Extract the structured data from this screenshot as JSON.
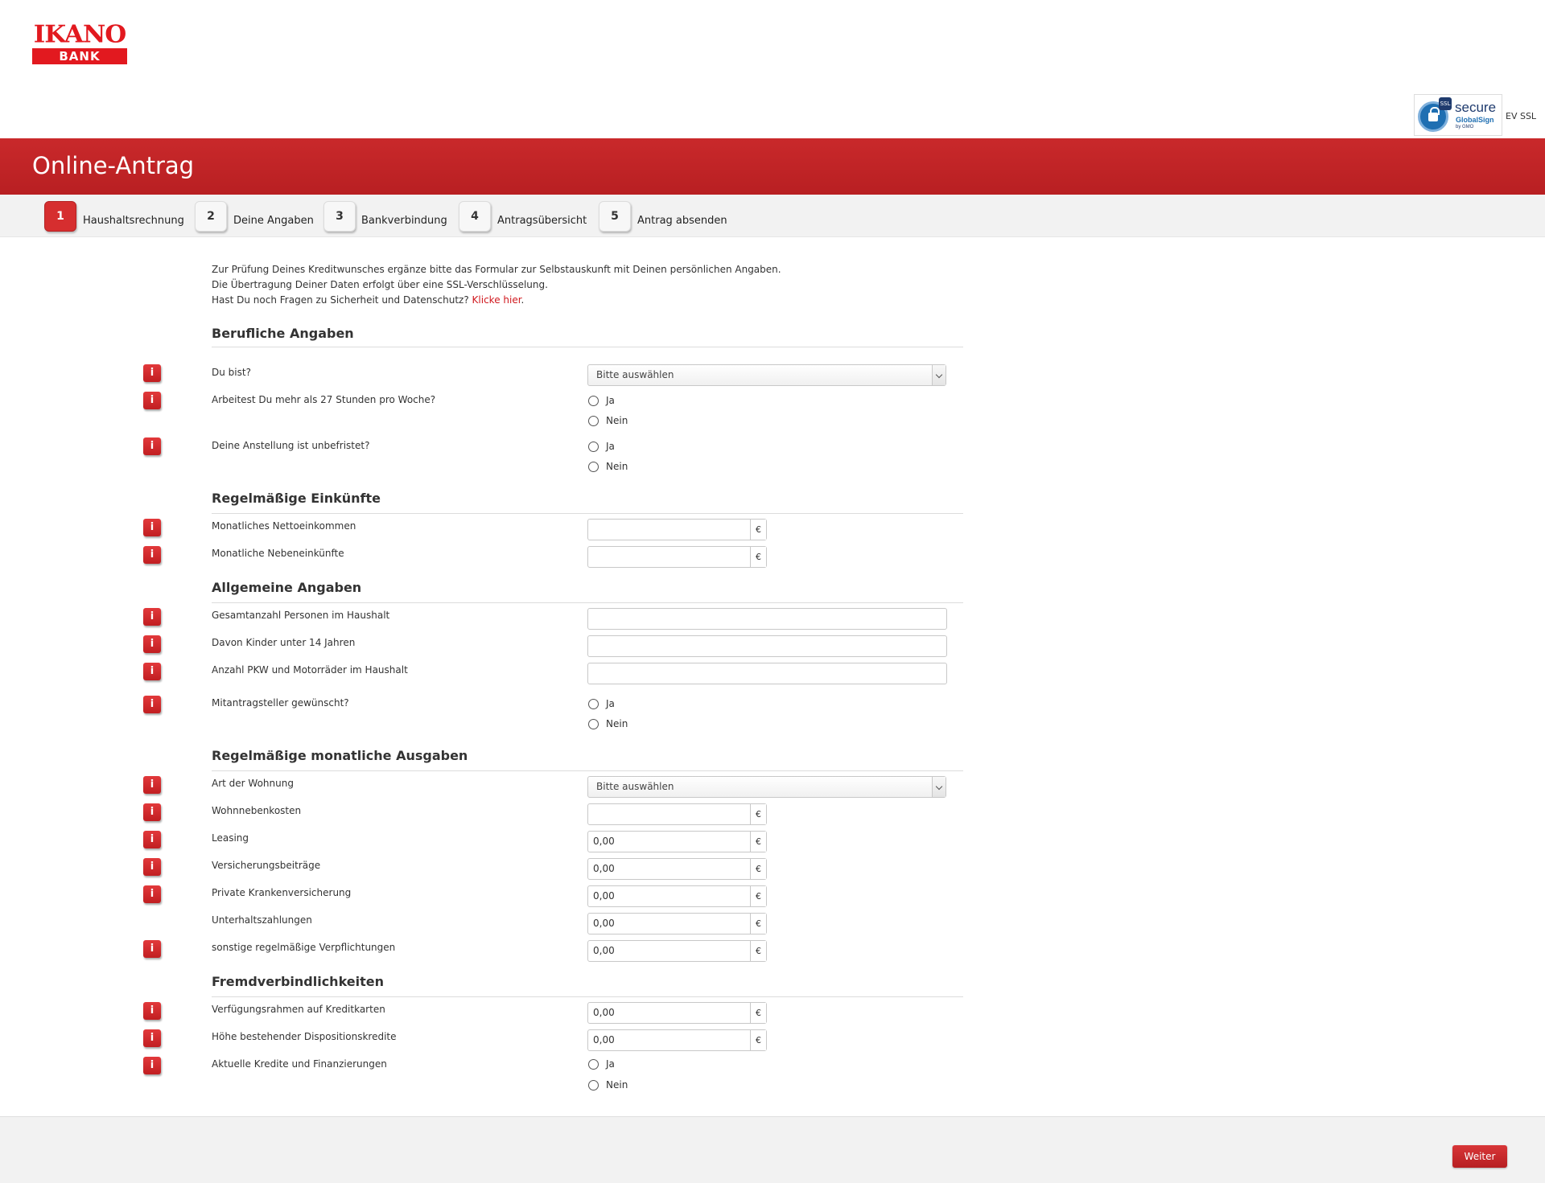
{
  "logo": {
    "top": "IKANO",
    "bottom": "BANK"
  },
  "ssl": {
    "tag": "SSL",
    "secure": "secure",
    "brand": "GlobalSign",
    "gmo": "by GMO",
    "ev": "EV SSL"
  },
  "banner": {
    "title": "Online-Antrag"
  },
  "steps": [
    {
      "num": "1",
      "label": "Haushaltsrechnung",
      "active": true
    },
    {
      "num": "2",
      "label": "Deine Angaben",
      "active": false
    },
    {
      "num": "3",
      "label": "Bankverbindung",
      "active": false
    },
    {
      "num": "4",
      "label": "Antragsübersicht",
      "active": false
    },
    {
      "num": "5",
      "label": "Antrag absenden",
      "active": false
    }
  ],
  "intro": {
    "line1": "Zur Prüfung Deines Kreditwunsches ergänze bitte das Formular zur Selbstauskunft mit Deinen persönlichen Angaben.",
    "line2": "Die Übertragung Deiner Daten erfolgt über eine SSL-Verschlüsselung.",
    "line3": "Hast Du noch Fragen zu Sicherheit und Datenschutz?",
    "link": "Klicke hier",
    "after_link": "."
  },
  "info_glyph": "i",
  "radio": {
    "yes": "Ja",
    "no": "Nein"
  },
  "currency": "€",
  "sections": {
    "beruf": {
      "title": "Berufliche Angaben",
      "du_bist": {
        "label": "Du bist?",
        "value": "Bitte auswählen"
      },
      "stunden": {
        "label": "Arbeitest Du mehr als 27 Stunden pro Woche?"
      },
      "unbefristet": {
        "label": "Deine Anstellung ist unbefristet?"
      }
    },
    "einkuenfte": {
      "title": "Regelmäßige Einkünfte",
      "netto": {
        "label": "Monatliches Nettoeinkommen",
        "value": ""
      },
      "neben": {
        "label": "Monatliche Nebeneinkünfte",
        "value": ""
      }
    },
    "allgemein": {
      "title": "Allgemeine Angaben",
      "personen": {
        "label": "Gesamtanzahl Personen im Haushalt",
        "value": ""
      },
      "kinder": {
        "label": "Davon Kinder unter 14 Jahren",
        "value": ""
      },
      "pkw": {
        "label": "Anzahl PKW und Motorräder im Haushalt",
        "value": ""
      },
      "mitantrag": {
        "label": "Mitantragsteller gewünscht?"
      }
    },
    "ausgaben": {
      "title": "Regelmäßige monatliche Ausgaben",
      "wohnung": {
        "label": "Art der Wohnung",
        "value": "Bitte auswählen"
      },
      "nebenkosten": {
        "label": "Wohnnebenkosten",
        "value": ""
      },
      "leasing": {
        "label": "Leasing",
        "value": "0,00"
      },
      "versicherung": {
        "label": "Versicherungsbeiträge",
        "value": "0,00"
      },
      "kranken": {
        "label": "Private Krankenversicherung",
        "value": "0,00"
      },
      "unterhalt": {
        "label": "Unterhaltszahlungen",
        "value": "0,00"
      },
      "sonstige": {
        "label": "sonstige regelmäßige Verpflichtungen",
        "value": "0,00"
      }
    },
    "fremd": {
      "title": "Fremdverbindlichkeiten",
      "kreditkarten": {
        "label": "Verfügungsrahmen auf Kreditkarten",
        "value": "0,00"
      },
      "dispo": {
        "label": "Höhe bestehender Dispositionskredite",
        "value": "0,00"
      },
      "kredite": {
        "label": "Aktuelle Kredite und Finanzierungen"
      }
    }
  },
  "footer": {
    "button": "Weiter"
  },
  "colors": {
    "brand_red": "#d62e2f",
    "logo_red": "#e2191f",
    "link_red": "#d0181e"
  }
}
